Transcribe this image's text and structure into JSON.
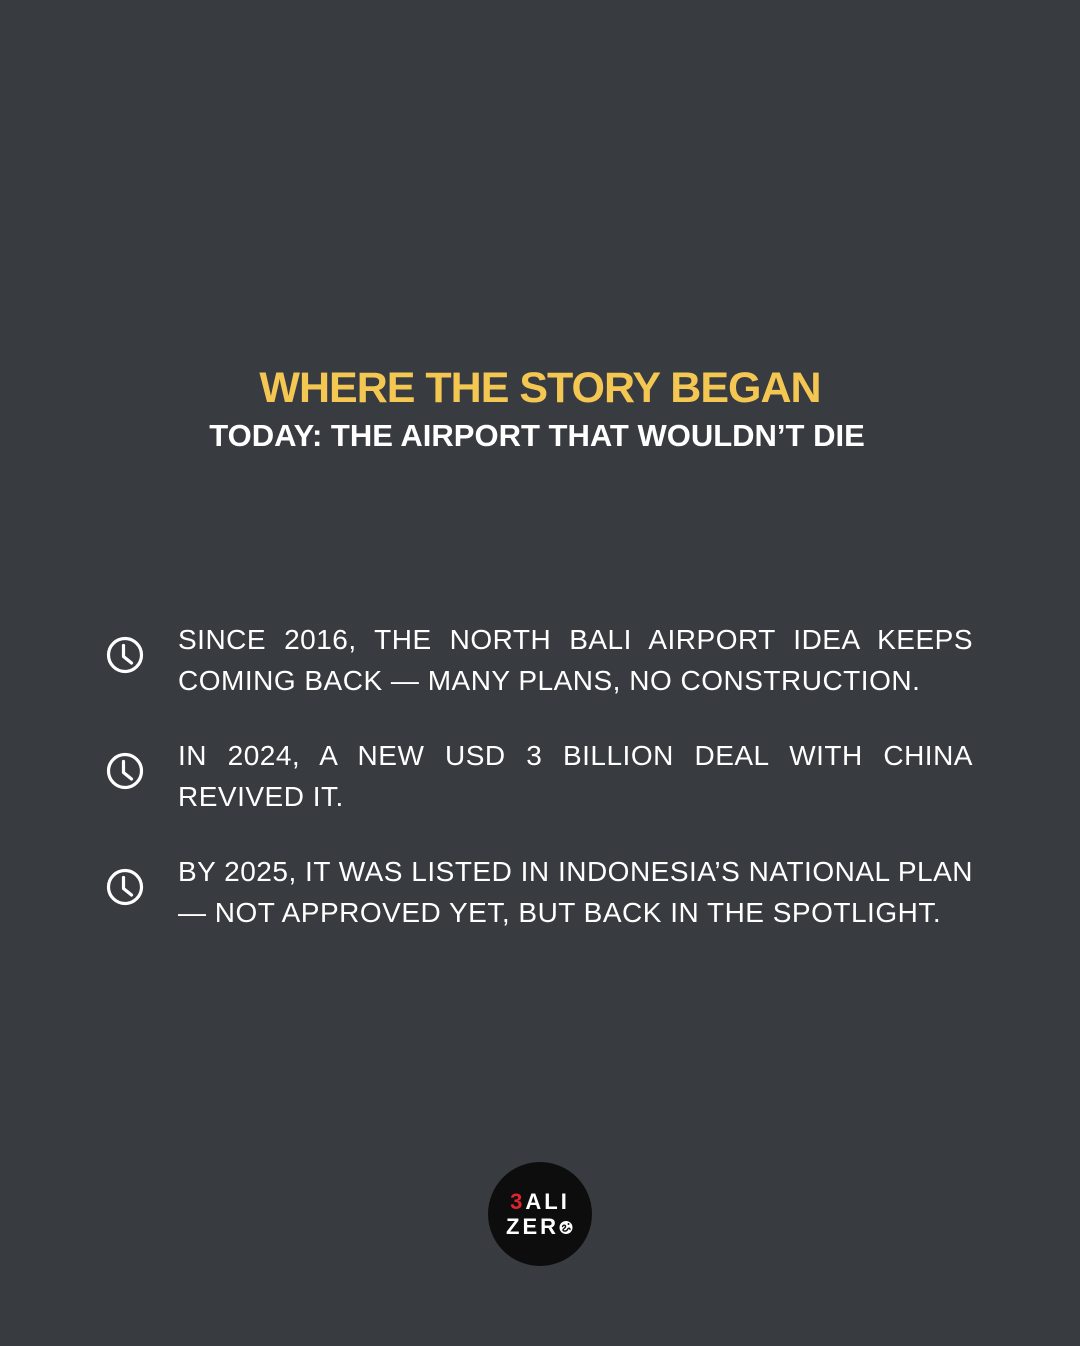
{
  "header": {
    "title": "WHERE THE STORY BEGAN",
    "subtitle": "TODAY: THE AIRPORT THAT WOULDN’T DIE"
  },
  "timeline": [
    {
      "icon": "clock-icon",
      "text": "SINCE 2016, THE NORTH BALI AIRPORT IDEA KEEPS COMING BACK — MANY PLANS, NO CONSTRUCTION."
    },
    {
      "icon": "clock-icon",
      "text": "IN 2024, A NEW USD 3 BILLION DEAL WITH CHINA REVIVED IT."
    },
    {
      "icon": "clock-icon",
      "text": "BY 2025, IT WAS LISTED IN INDONESIA’S NATIONAL PLAN — NOT APPROVED YET, BUT BACK IN THE SPOTLIGHT."
    }
  ],
  "logo": {
    "line1_accent": "3",
    "line1_rest": "ALI",
    "line2": "ZER"
  },
  "colors": {
    "background": "#383c40",
    "title": "#f4c652",
    "text": "#ffffff",
    "logo_bg": "#0d0d0d",
    "logo_accent": "#e0242b"
  }
}
